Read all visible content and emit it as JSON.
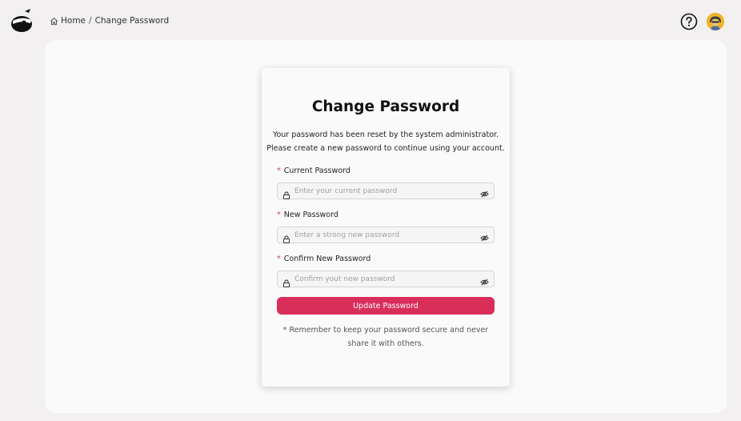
{
  "breadcrumb": {
    "home": "Home",
    "separator": "/",
    "current": "Change Password"
  },
  "icons": {
    "logo": "ninja-logo-icon",
    "home": "home-icon",
    "help": "question-circle-icon",
    "avatar": "user-avatar",
    "lock": "lock-icon",
    "eye": "eye-slash-icon"
  },
  "card": {
    "title": "Change Password",
    "description_line1": "Your password has been reset by the system administrator.",
    "description_line2": "Please create a new password to continue using your account.",
    "fields": [
      {
        "required_mark": "*",
        "label": "Current Password",
        "placeholder": "Enter your current password",
        "value": ""
      },
      {
        "required_mark": "*",
        "label": "New Password",
        "placeholder": "Enter a strong new password",
        "value": ""
      },
      {
        "required_mark": "*",
        "label": "Confirm New Password",
        "placeholder": "Confirm yout new password",
        "value": ""
      }
    ],
    "submit_label": "Update Password",
    "note": "* Remember to keep your password secure and never share it with others."
  },
  "colors": {
    "accent": "#d92e5a",
    "page_background": "#f2f0f0",
    "panel_background": "#fafafa",
    "required_mark": "#e2384f",
    "avatar_background": "#f0b429"
  }
}
